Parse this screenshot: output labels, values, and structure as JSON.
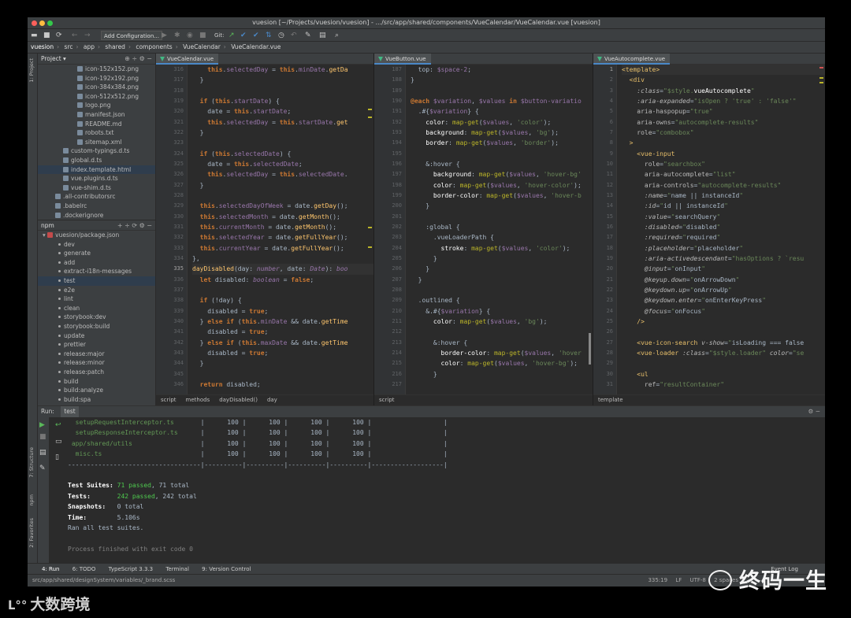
{
  "window": {
    "title": "vuesion [~/Projects/vuesion/vuesion] - .../src/app/shared/components/VueCalendar/VueCalendar.vue [vuesion]"
  },
  "toolbar": {
    "add_config": "Add Configuration...",
    "git_label": "Git:"
  },
  "breadcrumb": [
    "vuesion",
    "src",
    "app",
    "shared",
    "components",
    "VueCalendar",
    "VueCalendar.vue"
  ],
  "side_tabs": {
    "project": "1: Project",
    "structure": "7: Structure",
    "npm": "npm",
    "favorites": "2: Favorites"
  },
  "project": {
    "header": "Project",
    "files": [
      {
        "name": "icon-152x152.png",
        "indent": 50,
        "sel": false
      },
      {
        "name": "icon-192x192.png",
        "indent": 50,
        "sel": false
      },
      {
        "name": "icon-384x384.png",
        "indent": 50,
        "sel": false
      },
      {
        "name": "icon-512x512.png",
        "indent": 50,
        "sel": false
      },
      {
        "name": "logo.png",
        "indent": 50,
        "sel": false
      },
      {
        "name": "manifest.json",
        "indent": 50,
        "sel": false
      },
      {
        "name": "README.md",
        "indent": 50,
        "sel": false
      },
      {
        "name": "robots.txt",
        "indent": 50,
        "sel": false
      },
      {
        "name": "sitemap.xml",
        "indent": 50,
        "sel": false
      },
      {
        "name": "custom-typings.d.ts",
        "indent": 32,
        "sel": false
      },
      {
        "name": "global.d.ts",
        "indent": 32,
        "sel": false
      },
      {
        "name": "index.template.html",
        "indent": 32,
        "sel": true
      },
      {
        "name": "vue.plugins.d.ts",
        "indent": 32,
        "sel": false
      },
      {
        "name": "vue-shim.d.ts",
        "indent": 32,
        "sel": false
      },
      {
        "name": ".all-contributorsrc",
        "indent": 22,
        "sel": false
      },
      {
        "name": ".babelrc",
        "indent": 22,
        "sel": false
      },
      {
        "name": ".dockerignore",
        "indent": 22,
        "sel": false
      }
    ]
  },
  "npm": {
    "header": "npm",
    "package": "vuesion/package.json",
    "scripts": [
      "dev",
      "generate",
      "add",
      "extract-i18n-messages",
      "test",
      "e2e",
      "lint",
      "clean",
      "storybook:dev",
      "storybook:build",
      "update",
      "prettier",
      "release:major",
      "release:minor",
      "release:patch",
      "build",
      "build:analyze",
      "build:spa"
    ],
    "selected": "test"
  },
  "editor1": {
    "tab": "VueCalendar.vue",
    "lines": [
      {
        "n": "316",
        "html": "    <span class=\"k\">this</span>.<span class=\"n\">selectedDay</span> = <span class=\"k\">this</span>.<span class=\"n\">minDate</span>.<span class=\"f\">getDa</span>"
      },
      {
        "n": "317",
        "html": "  }"
      },
      {
        "n": "318",
        "html": ""
      },
      {
        "n": "319",
        "html": "  <span class=\"k\">if</span> (<span class=\"k\">this</span>.<span class=\"n\">startDate</span>) {"
      },
      {
        "n": "320",
        "html": "    date = <span class=\"k\">this</span>.<span class=\"n\">startDate</span>;"
      },
      {
        "n": "321",
        "html": "    <span class=\"k\">this</span>.<span class=\"n\">selectedDay</span> = <span class=\"k\">this</span>.<span class=\"n\">startDate</span>.<span class=\"f\">get</span>"
      },
      {
        "n": "322",
        "html": "  }"
      },
      {
        "n": "323",
        "html": ""
      },
      {
        "n": "324",
        "html": "  <span class=\"k\">if</span> (<span class=\"k\">this</span>.<span class=\"n\">selectedDate</span>) {"
      },
      {
        "n": "325",
        "html": "    date = <span class=\"k\">this</span>.<span class=\"n\">selectedDate</span>;"
      },
      {
        "n": "326",
        "html": "    <span class=\"k\">this</span>.<span class=\"n\">selectedDay</span> = <span class=\"k\">this</span>.<span class=\"n\">selectedDate</span>."
      },
      {
        "n": "327",
        "html": "  }"
      },
      {
        "n": "328",
        "html": ""
      },
      {
        "n": "329",
        "html": "  <span class=\"k\">this</span>.<span class=\"n\">selectedDayOfWeek</span> = date.<span class=\"f\">getDay</span>();"
      },
      {
        "n": "330",
        "html": "  <span class=\"k\">this</span>.<span class=\"n\">selectedMonth</span> = date.<span class=\"f\">getMonth</span>();"
      },
      {
        "n": "331",
        "html": "  <span class=\"k\">this</span>.<span class=\"n\">currentMonth</span> = date.<span class=\"f\">getMonth</span>();"
      },
      {
        "n": "332",
        "html": "  <span class=\"k\">this</span>.<span class=\"n\">selectedYear</span> = date.<span class=\"f\">getFullYear</span>();"
      },
      {
        "n": "333",
        "html": "  <span class=\"k\">this</span>.<span class=\"n\">currentYear</span> = date.<span class=\"f\">getFullYear</span>();"
      },
      {
        "n": "334",
        "html": "},"
      },
      {
        "n": "335",
        "html": "<span class=\"f\">dayDisabled</span>(day: <span class=\"p\">number</span>, date: <span class=\"p\">Date</span>): <span class=\"p\">boo</span>",
        "cur": true
      },
      {
        "n": "336",
        "html": "  <span class=\"k\">let</span> disabled: <span class=\"p\">boolean</span> = <span class=\"k\">false</span>;"
      },
      {
        "n": "337",
        "html": ""
      },
      {
        "n": "338",
        "html": "  <span class=\"k\">if</span> (!day) {"
      },
      {
        "n": "339",
        "html": "    disabled = <span class=\"k\">true</span>;"
      },
      {
        "n": "340",
        "html": "  } <span class=\"k\">else if</span> (<span class=\"k\">this</span>.<span class=\"n\">minDate</span> &amp;&amp; date.<span class=\"f\">getTime</span>"
      },
      {
        "n": "341",
        "html": "    disabled = <span class=\"k\">true</span>;"
      },
      {
        "n": "342",
        "html": "  } <span class=\"k\">else if</span> (<span class=\"k\">this</span>.<span class=\"n\">maxDate</span> &amp;&amp; date.<span class=\"f\">getTime</span>"
      },
      {
        "n": "343",
        "html": "    disabled = <span class=\"k\">true</span>;"
      },
      {
        "n": "344",
        "html": "  }"
      },
      {
        "n": "345",
        "html": ""
      },
      {
        "n": "346",
        "html": "  <span class=\"k\">return</span> disabled;"
      }
    ],
    "breadcrumb": [
      "script",
      "methods",
      "dayDisabled()",
      "day"
    ]
  },
  "editor2": {
    "tab": "VueButton.vue",
    "lines": [
      {
        "n": "187",
        "html": "  top: <span class=\"n\">$space-2</span>;"
      },
      {
        "n": "188",
        "html": "}"
      },
      {
        "n": "189",
        "html": ""
      },
      {
        "n": "190",
        "html": "<span class=\"k\">@each</span> <span class=\"n\">$variation</span>, <span class=\"n\">$values</span> <span class=\"k\">in</span> <span class=\"n\">$button-variatio</span>"
      },
      {
        "n": "191",
        "html": "  .#{<span class=\"n\">$variation</span>} {"
      },
      {
        "n": "192",
        "html": "    <span class=\"w\">color</span>: <span class=\"y\">map-get</span>(<span class=\"n\">$values</span>, <span class=\"s\">'color'</span>);"
      },
      {
        "n": "193",
        "html": "    <span class=\"w\">background</span>: <span class=\"y\">map-get</span>(<span class=\"n\">$values</span>, <span class=\"s\">'bg'</span>);"
      },
      {
        "n": "194",
        "html": "    <span class=\"w\">border</span>: <span class=\"y\">map-get</span>(<span class=\"n\">$values</span>, <span class=\"s\">'border'</span>);"
      },
      {
        "n": "195",
        "html": ""
      },
      {
        "n": "196",
        "html": "    &amp;:hover {"
      },
      {
        "n": "197",
        "html": "      <span class=\"w\">background</span>: <span class=\"y\">map-get</span>(<span class=\"n\">$values</span>, <span class=\"s\">'hover-bg'</span>"
      },
      {
        "n": "198",
        "html": "      <span class=\"w\">color</span>: <span class=\"y\">map-get</span>(<span class=\"n\">$values</span>, <span class=\"s\">'hover-color'</span>);"
      },
      {
        "n": "199",
        "html": "      <span class=\"w\">border-color</span>: <span class=\"y\">map-get</span>(<span class=\"n\">$values</span>, <span class=\"s\">'hover-b</span>"
      },
      {
        "n": "200",
        "html": "    }"
      },
      {
        "n": "201",
        "html": ""
      },
      {
        "n": "202",
        "html": "    :global {"
      },
      {
        "n": "203",
        "html": "      .vueLoaderPath {"
      },
      {
        "n": "204",
        "html": "        <span class=\"w\">stroke</span>: <span class=\"y\">map-get</span>(<span class=\"n\">$values</span>, <span class=\"s\">'color'</span>);"
      },
      {
        "n": "205",
        "html": "      }"
      },
      {
        "n": "206",
        "html": "    }"
      },
      {
        "n": "207",
        "html": "  }"
      },
      {
        "n": "208",
        "html": ""
      },
      {
        "n": "209",
        "html": "  .outlined {"
      },
      {
        "n": "210",
        "html": "    &amp;.#{<span class=\"n\">$variation</span>} {"
      },
      {
        "n": "211",
        "html": "      <span class=\"w\">color</span>: <span class=\"y\">map-get</span>(<span class=\"n\">$values</span>, <span class=\"s\">'bg'</span>);"
      },
      {
        "n": "212",
        "html": ""
      },
      {
        "n": "213",
        "html": "      &amp;:hover {"
      },
      {
        "n": "214",
        "html": "        <span class=\"w\">border-color</span>: <span class=\"y\">map-get</span>(<span class=\"n\">$values</span>, <span class=\"s\">'hover</span>"
      },
      {
        "n": "215",
        "html": "        <span class=\"w\">color</span>: <span class=\"y\">map-get</span>(<span class=\"n\">$values</span>, <span class=\"s\">'hover-bg'</span>);"
      },
      {
        "n": "216",
        "html": "      }"
      },
      {
        "n": "217",
        "html": ""
      }
    ],
    "breadcrumb": [
      "script"
    ]
  },
  "editor3": {
    "tab": "VueAutocomplete.vue",
    "lines": [
      {
        "n": "1",
        "html": "<span class=\"t\">&lt;template&gt;</span>",
        "cur": true
      },
      {
        "n": "2",
        "html": "  <span class=\"t\">&lt;div</span>"
      },
      {
        "n": "3",
        "html": "    <span class=\"ai\">:class</span>=<span class=\"s\">\"$style.</span><span class=\"w\">vueAutocomplete</span><span class=\"s\">\"</span>"
      },
      {
        "n": "4",
        "html": "    <span class=\"ai\">:aria-expanded</span>=<span class=\"s\">\"isOpen ? 'true' : 'false'\"</span>"
      },
      {
        "n": "5",
        "html": "    <span class=\"a\">aria-haspopup</span>=<span class=\"s\">\"true\"</span>"
      },
      {
        "n": "6",
        "html": "    <span class=\"a\">aria-owns</span>=<span class=\"s\">\"autocomplete-results\"</span>"
      },
      {
        "n": "7",
        "html": "    <span class=\"a\">role</span>=<span class=\"s\">\"combobox\"</span>"
      },
      {
        "n": "8",
        "html": "  <span class=\"t\">&gt;</span>"
      },
      {
        "n": "9",
        "html": "    <span class=\"t\">&lt;vue-input</span>"
      },
      {
        "n": "10",
        "html": "      <span class=\"a\">role</span>=<span class=\"s\">\"searchbox\"</span>"
      },
      {
        "n": "11",
        "html": "      <span class=\"a\">aria-autocomplete</span>=<span class=\"s\">\"list\"</span>"
      },
      {
        "n": "12",
        "html": "      <span class=\"a\">aria-controls</span>=<span class=\"s\">\"autocomplete-results\"</span>"
      },
      {
        "n": "13",
        "html": "      <span class=\"ai\">:name</span>=<span class=\"s\">\"</span>name || instanceId<span class=\"s\">\"</span>"
      },
      {
        "n": "14",
        "html": "      <span class=\"ai\">:id</span>=<span class=\"s\">\"</span>id || instanceId<span class=\"s\">\"</span>"
      },
      {
        "n": "15",
        "html": "      <span class=\"ai\">:value</span>=<span class=\"s\">\"</span>searchQuery<span class=\"s\">\"</span>"
      },
      {
        "n": "16",
        "html": "      <span class=\"ai\">:disabled</span>=<span class=\"s\">\"</span>disabled<span class=\"s\">\"</span>"
      },
      {
        "n": "17",
        "html": "      <span class=\"ai\">:required</span>=<span class=\"s\">\"</span>required<span class=\"s\">\"</span>"
      },
      {
        "n": "18",
        "html": "      <span class=\"ai\">:placeholder</span>=<span class=\"s\">\"</span>placeholder<span class=\"s\">\"</span>"
      },
      {
        "n": "19",
        "html": "      <span class=\"ai\">:aria-activedescendant</span>=<span class=\"s\">\"hasOptions ? `resu</span>"
      },
      {
        "n": "20",
        "html": "      <span class=\"ai\">@input</span>=<span class=\"s\">\"</span>onInput<span class=\"s\">\"</span>"
      },
      {
        "n": "21",
        "html": "      <span class=\"ai\">@keyup.down</span>=<span class=\"s\">\"</span>onArrowDown<span class=\"s\">\"</span>"
      },
      {
        "n": "22",
        "html": "      <span class=\"ai\">@keydown.up</span>=<span class=\"s\">\"</span>onArrowUp<span class=\"s\">\"</span>"
      },
      {
        "n": "23",
        "html": "      <span class=\"ai\">@keydown.enter</span>=<span class=\"s\">\"</span>onEnterKeyPress<span class=\"s\">\"</span>"
      },
      {
        "n": "24",
        "html": "      <span class=\"ai\">@focus</span>=<span class=\"s\">\"</span>onFocus<span class=\"s\">\"</span>"
      },
      {
        "n": "25",
        "html": "    <span class=\"t\">/&gt;</span>"
      },
      {
        "n": "26",
        "html": ""
      },
      {
        "n": "27",
        "html": "    <span class=\"t\">&lt;vue-icon-search</span> <span class=\"ai\">v-show</span>=<span class=\"s\">\"</span>isLoading === false"
      },
      {
        "n": "28",
        "html": "    <span class=\"t\">&lt;vue-loader</span> <span class=\"ai\">:class</span>=<span class=\"s\">\"$style.loader\"</span> <span class=\"ai\">color</span>=<span class=\"s\">\"se</span>"
      },
      {
        "n": "29",
        "html": ""
      },
      {
        "n": "30",
        "html": "    <span class=\"t\">&lt;ul</span>"
      },
      {
        "n": "31",
        "html": "      <span class=\"a\">ref</span>=<span class=\"s\">\"resultContainer\"</span>"
      }
    ],
    "breadcrumb": [
      "template"
    ]
  },
  "run": {
    "label": "Run:",
    "tab": "test",
    "lines": [
      {
        "html": "  <span class=\"g\">setupRequestInterceptor.ts</span>       |      100 |      100 |      100 |      100 |                   |"
      },
      {
        "html": "  <span class=\"g\">setupResponseInterceptor.ts</span>      |      100 |      100 |      100 |      100 |                   |"
      },
      {
        "html": " <span class=\"g\">app/shared/utils</span>                  |      100 |      100 |      100 |      100 |                   |"
      },
      {
        "html": "  <span class=\"g\">misc.ts</span>                          |      100 |      100 |      100 |      100 |                   |"
      },
      {
        "html": "-----------------------------------|----------|----------|----------|----------|-------------------|"
      },
      {
        "html": ""
      },
      {
        "html": "<b class=\"w\">Test Suites:</b> <span class=\"green\">71 passed</span>, 71 total"
      },
      {
        "html": "<b class=\"w\">Tests:</b>       <span class=\"green\">242 passed</span>, 242 total"
      },
      {
        "html": "<b class=\"w\">Snapshots:</b>   0 total"
      },
      {
        "html": "<b class=\"w\">Time:</b>        5.106s"
      },
      {
        "html": "Ran all test suites."
      },
      {
        "html": ""
      },
      {
        "html": "<span class=\"gr\">Process finished with exit code 0</span>"
      }
    ]
  },
  "bottom_tabs": [
    "4: Run",
    "6: TODO",
    "TypeScript 3.3.3",
    "Terminal",
    "9: Version Control"
  ],
  "status": {
    "path": "src/app/shared/designSystem/variables/_brand.scss",
    "position": "335:19",
    "line_ending": "LF",
    "encoding": "UTF-8",
    "indent": "2 spaces",
    "event_log": "Event Log"
  },
  "watermarks": {
    "wechat": "终码一生",
    "corner": "大数跨境"
  }
}
